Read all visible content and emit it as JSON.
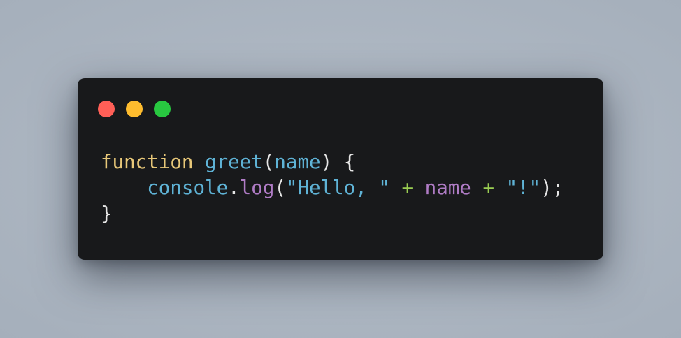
{
  "window": {
    "controls": {
      "close_color": "#ff5f57",
      "minimize_color": "#febc2e",
      "maximize_color": "#28c840"
    }
  },
  "code": {
    "language": "javascript",
    "lines": [
      {
        "indent": "",
        "tokens": [
          {
            "type": "keyword",
            "text": "function"
          },
          {
            "type": "space",
            "text": " "
          },
          {
            "type": "func",
            "text": "greet"
          },
          {
            "type": "punct",
            "text": "("
          },
          {
            "type": "param",
            "text": "name"
          },
          {
            "type": "punct",
            "text": ") {"
          }
        ]
      },
      {
        "indent": "    ",
        "tokens": [
          {
            "type": "obj",
            "text": "console"
          },
          {
            "type": "punct",
            "text": "."
          },
          {
            "type": "method",
            "text": "log"
          },
          {
            "type": "punct",
            "text": "("
          },
          {
            "type": "string",
            "text": "\"Hello, \""
          },
          {
            "type": "space",
            "text": " "
          },
          {
            "type": "op",
            "text": "+"
          },
          {
            "type": "space",
            "text": " "
          },
          {
            "type": "var",
            "text": "name"
          },
          {
            "type": "space",
            "text": " "
          },
          {
            "type": "op",
            "text": "+"
          },
          {
            "type": "space",
            "text": " "
          },
          {
            "type": "string",
            "text": "\"!\""
          },
          {
            "type": "punct",
            "text": ");"
          }
        ]
      },
      {
        "indent": "",
        "tokens": [
          {
            "type": "punct",
            "text": "}"
          }
        ]
      }
    ]
  },
  "colors": {
    "background": "#a9b3bf",
    "window_bg": "#18191b",
    "keyword": "#e8c879",
    "identifier": "#5fb3d6",
    "method": "#b07cc6",
    "operator": "#9acd52",
    "punctuation": "#e6e6e6"
  }
}
